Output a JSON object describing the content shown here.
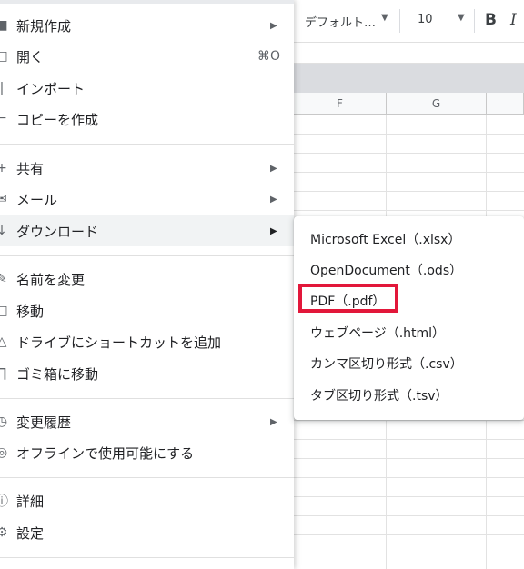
{
  "toolbar": {
    "font_name": "デフォルト…",
    "font_size": "10",
    "bold_label": "B",
    "italic_label": "I"
  },
  "sheet": {
    "columns": [
      "F",
      "G"
    ]
  },
  "menu": {
    "items": [
      {
        "label": "新規作成",
        "icon": "new-doc-icon",
        "has_submenu": true
      },
      {
        "label": "開く",
        "icon": "folder-open-icon",
        "shortcut": "⌘O"
      },
      {
        "label": "インポート",
        "icon": "import-icon"
      },
      {
        "label": "コピーを作成",
        "icon": "copy-icon"
      },
      {
        "label": "共有",
        "icon": "share-icon",
        "has_submenu": true
      },
      {
        "label": "メール",
        "icon": "mail-icon",
        "has_submenu": true
      },
      {
        "label": "ダウンロード",
        "icon": "download-icon",
        "has_submenu": true,
        "highlighted": true
      },
      {
        "label": "名前を変更",
        "icon": "rename-icon"
      },
      {
        "label": "移動",
        "icon": "move-icon"
      },
      {
        "label": "ドライブにショートカットを追加",
        "icon": "drive-shortcut-icon"
      },
      {
        "label": "ゴミ箱に移動",
        "icon": "trash-icon"
      },
      {
        "label": "変更履歴",
        "icon": "history-icon",
        "has_submenu": true
      },
      {
        "label": "オフラインで使用可能にする",
        "icon": "offline-icon"
      },
      {
        "label": "詳細",
        "icon": "info-icon"
      },
      {
        "label": "設定",
        "icon": "settings-icon"
      }
    ],
    "submenu_arrow": "▶"
  },
  "download_submenu": {
    "items": [
      {
        "label": "Microsoft Excel（.xlsx）"
      },
      {
        "label": "OpenDocument（.ods）"
      },
      {
        "label": "PDF（.pdf）",
        "highlighted_box": true
      },
      {
        "label": "ウェブページ（.html）"
      },
      {
        "label": "カンマ区切り形式（.csv）"
      },
      {
        "label": "タブ区切り形式（.tsv）"
      }
    ]
  },
  "colors": {
    "highlight_box": "#e2173a",
    "hover_row": "#f1f3f4"
  }
}
